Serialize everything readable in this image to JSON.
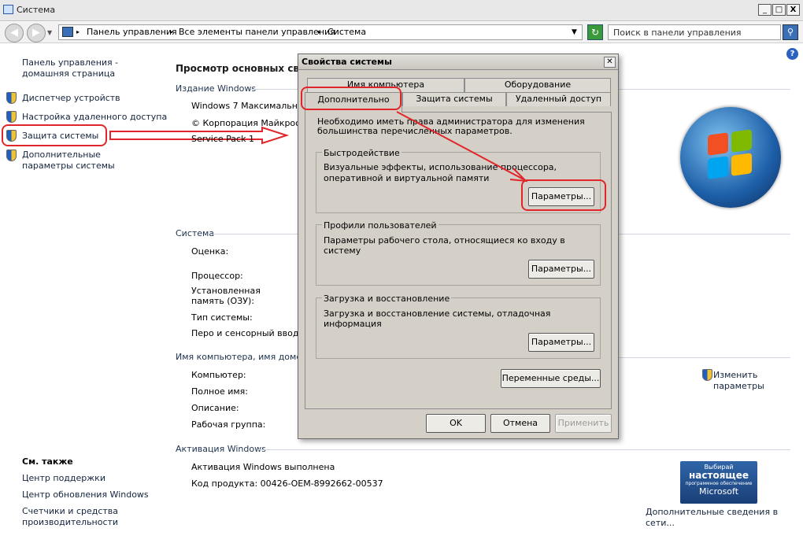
{
  "window": {
    "title": "Система",
    "min": "_",
    "max": "□",
    "close": "X"
  },
  "toolbar": {
    "crumbs": [
      "Панель управления",
      "Все элементы панели управления",
      "Система"
    ],
    "search_placeholder": "Поиск в панели управления"
  },
  "help": "?",
  "sidebar": {
    "home": "Панель управления - домашняя страница",
    "items": [
      {
        "label": "Диспетчер устройств"
      },
      {
        "label": "Настройка удаленного доступа"
      },
      {
        "label": "Защита системы"
      },
      {
        "label": "Дополнительные параметры системы"
      }
    ],
    "see_also": "См. также",
    "see_also_items": [
      "Центр поддержки",
      "Центр обновления Windows",
      "Счетчики и средства производительности"
    ]
  },
  "main": {
    "heading": "Просмотр основных сведе",
    "edition_head": "Издание Windows",
    "edition": "Windows 7 Максимальная",
    "copyright": "© Корпорация Майкрософ",
    "service_pack": "Service Pack 1",
    "system_head": "Система",
    "rating": "Оценка:",
    "processor": "Процессор:",
    "ram": "Установленная память (ОЗУ):",
    "systype": "Тип системы:",
    "pen": "Перо и сенсорный ввод:",
    "name_head": "Имя компьютера, имя домена",
    "computer": "Компьютер:",
    "fullname": "Полное имя:",
    "description": "Описание:",
    "workgroup": "Рабочая группа:",
    "change": "Изменить параметры",
    "activation_head": "Активация Windows",
    "activation": "Активация Windows выполнена",
    "product_key": "Код продукта:  00426-OEM-8992662-00537",
    "more_info": "Дополнительные сведения в сети..."
  },
  "badge": {
    "line1": "Выбирай",
    "line2": "настоящее",
    "line3": "программное обеспечение",
    "line4": "Microsoft"
  },
  "dialog": {
    "title": "Свойства системы",
    "close": "✕",
    "tabs_row1": [
      "Имя компьютера",
      "Оборудование"
    ],
    "tabs_row2": [
      "Дополнительно",
      "Защита системы",
      "Удаленный доступ"
    ],
    "admin_note": "Необходимо иметь права администратора для изменения большинства перечисленных параметров.",
    "perf": {
      "title": "Быстродействие",
      "text": "Визуальные эффекты, использование процессора, оперативной и виртуальной памяти",
      "button": "Параметры..."
    },
    "profiles": {
      "title": "Профили пользователей",
      "text": "Параметры рабочего стола, относящиеся ко входу в систему",
      "button": "Параметры..."
    },
    "startup": {
      "title": "Загрузка и восстановление",
      "text": "Загрузка и восстановление системы, отладочная информация",
      "button": "Параметры..."
    },
    "env_button": "Переменные среды...",
    "ok": "OK",
    "cancel": "Отмена",
    "apply": "Применить"
  },
  "colors": {
    "annotation": "#e0262a",
    "link": "#14243c",
    "dialog_bg": "#d4d0c8"
  }
}
